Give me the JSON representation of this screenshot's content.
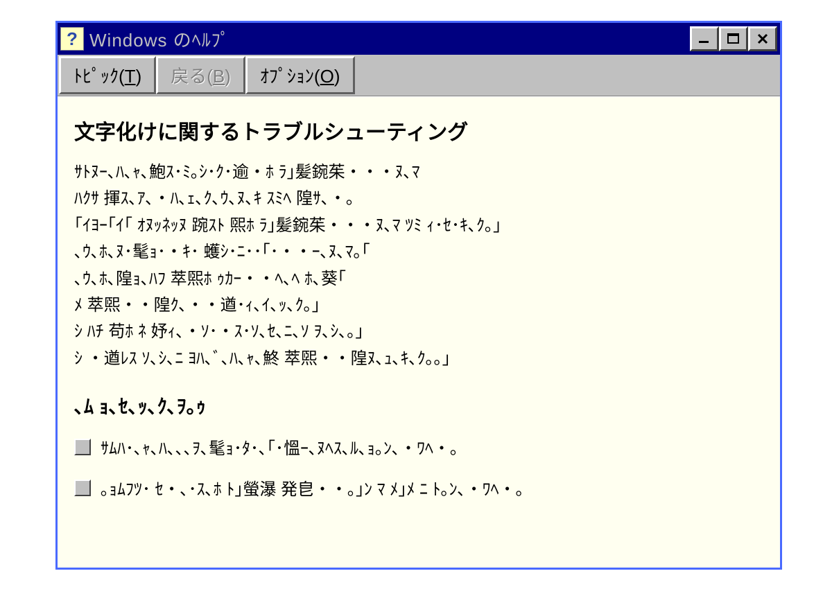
{
  "window": {
    "title": "Windows のﾍﾙﾌﾟ"
  },
  "toolbar": {
    "topics": {
      "label": "ﾄﾋﾟｯｸ(",
      "accel": "T",
      "suffix": ")"
    },
    "back": {
      "label": "戻る(",
      "accel": "B",
      "suffix": ")"
    },
    "options": {
      "label": "ｵﾌﾟｼｮﾝ(",
      "accel": "O",
      "suffix": ")"
    }
  },
  "content": {
    "heading": "文字化けに関するトラブルシューティング",
    "body": "ｻﾄﾇｰ､ﾊ､ｬ､鮑ｽ･ﾐ｡ｼ･ｸ･逾・ﾎ ﾗ｣髪鋺茱・・・ﾇ､ﾏ\nﾊｸｻ 揮ｽ､ｱ､・ﾊ､ｪ､ｸ､ｳ､ﾇ､ｷ ｽﾐﾍ 隍ｻ､・｡\n｢ｲﾖｰ｢ｲ｢ ｵﾇｯﾈｯﾇ 踠ｽﾄ 煕ﾎ ﾗ｣髪鋺茱・・・ﾇ､ﾏ ﾂﾐ ｨ･ｾ･ｷ､ｸ｡｣\n､ｳ､ﾎ､ﾇ･髦ｮ･・ｷ･ 蠖ｼ･ﾆ･･｢･・・ｰ､ﾇ､ﾏ｡｢\n､ｳ､ﾎ､隍ｮ､ﾊﾌ 萃煕ﾎ ｩｶｰ・・ﾍ､ﾍ ﾎ､葵｢\nﾒ 萃煕・・隍ｸ､・・遒･ｨ､ｲ､ｯ､ｸ｡｣\nｼ ﾊﾁ 苟ﾎ ﾈ 妤ｨ､・ｿ･・ｽ･ｿ､ｾ､ﾆ､ｿ ｦ､ｼ､｡｣\nｼ ・遒ﾚｽ ｿ､ｼ､ﾆ ﾖﾊ､ﾞ､ﾊ､ｬ､鮗 萃煕・・隍ﾇ､ｭ､ｷ､ｸ｡｡｣",
    "subheading": "､ﾑ ｮ､ｾ､ｯ､ｸ､ｦ｡ｩ",
    "items": [
      "ｻﾑﾊ･､ｬ､ﾊ､､､ｦ､髦ｮ･ﾀ･､｢･慍ｰ､ﾇﾍｽ､ﾙ､ｮ｡ﾝ､・ﾜﾍ・｡",
      "｡ｮﾑﾌﾂ･ ｾ・､･ｽ､ﾎ ﾄ｣螢瀑 発皀・・｡｣ﾝ ﾏ ﾒ｣ﾒ ﾆ ﾄ｡ﾝ､・ﾜﾍ・｡"
    ]
  }
}
